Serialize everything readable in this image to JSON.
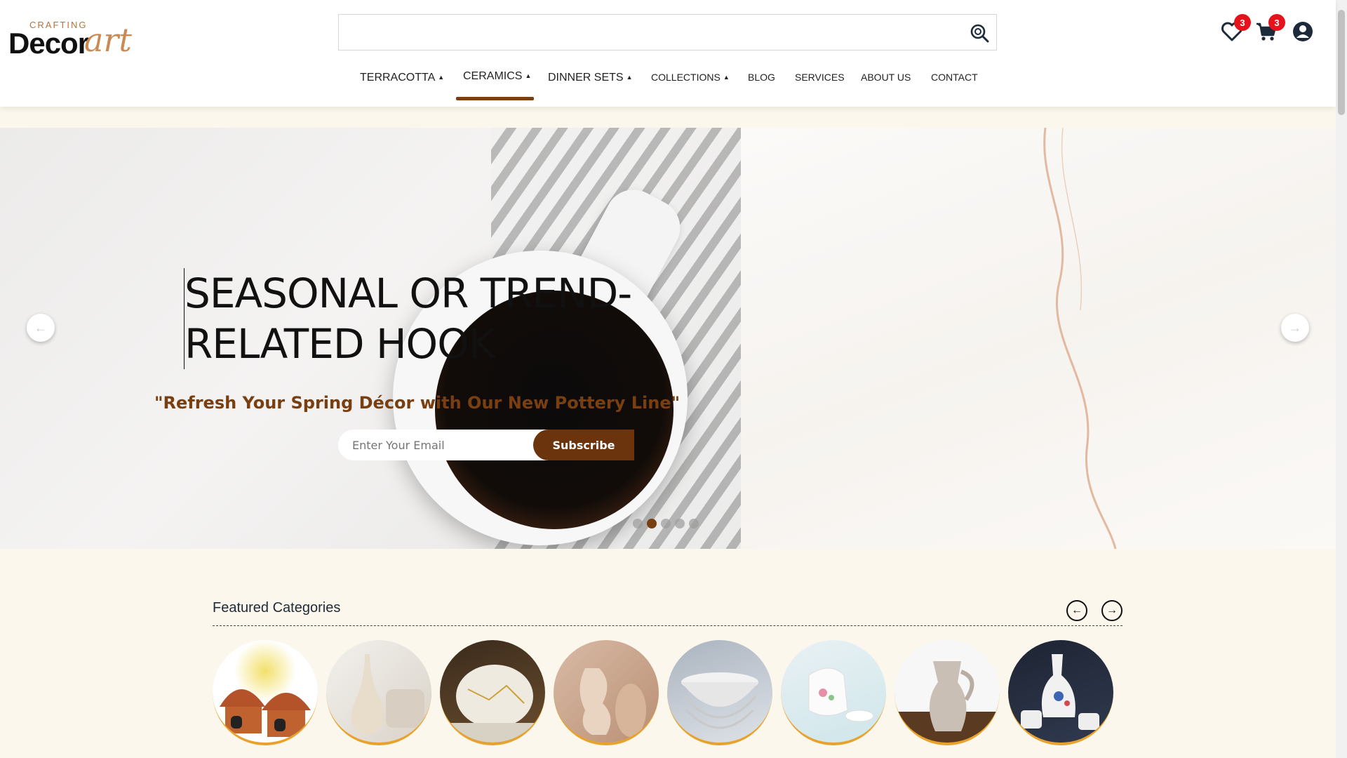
{
  "header": {
    "logo": {
      "small": "CRAFTING",
      "main": "Decor",
      "script": "art"
    },
    "search": {
      "placeholder": "",
      "value": ""
    },
    "wishlist_count": "3",
    "cart_count": "3"
  },
  "nav": {
    "items": [
      {
        "label": "TERRACOTTA",
        "dropdown": true
      },
      {
        "label": "CERAMICS",
        "dropdown": true,
        "active": true
      },
      {
        "label": "DINNER SETS",
        "dropdown": true
      },
      {
        "label": "COLLECTIONS",
        "dropdown": true
      },
      {
        "label": "BLOG",
        "dropdown": false
      },
      {
        "label": "SERVICES",
        "dropdown": false
      },
      {
        "label": "ABOUT US",
        "dropdown": false
      },
      {
        "label": "CONTACT",
        "dropdown": false
      }
    ]
  },
  "hero": {
    "title_line1": "SEASONAL OR TREND-",
    "title_line2": "RELATED HOOK",
    "subtitle": "\"Refresh Your Spring Décor with Our New Pottery Line\"",
    "email_placeholder": "Enter Your Email",
    "subscribe_label": "Subscribe",
    "slide_count": 5,
    "active_slide": 2
  },
  "featured": {
    "title": "Featured Categories",
    "categories": [
      {
        "icon": "terracotta-huts"
      },
      {
        "icon": "cream-vase"
      },
      {
        "icon": "kintsugi-bowl"
      },
      {
        "icon": "sculpted-vases"
      },
      {
        "icon": "stacked-bowls"
      },
      {
        "icon": "floral-teapot-set"
      },
      {
        "icon": "stone-pitcher"
      },
      {
        "icon": "blue-floral-vase-set"
      }
    ]
  },
  "colors": {
    "accent": "#7a3f10",
    "badge": "#e5141c",
    "cream": "#fbf7ec",
    "ring": "#e8a22c"
  }
}
